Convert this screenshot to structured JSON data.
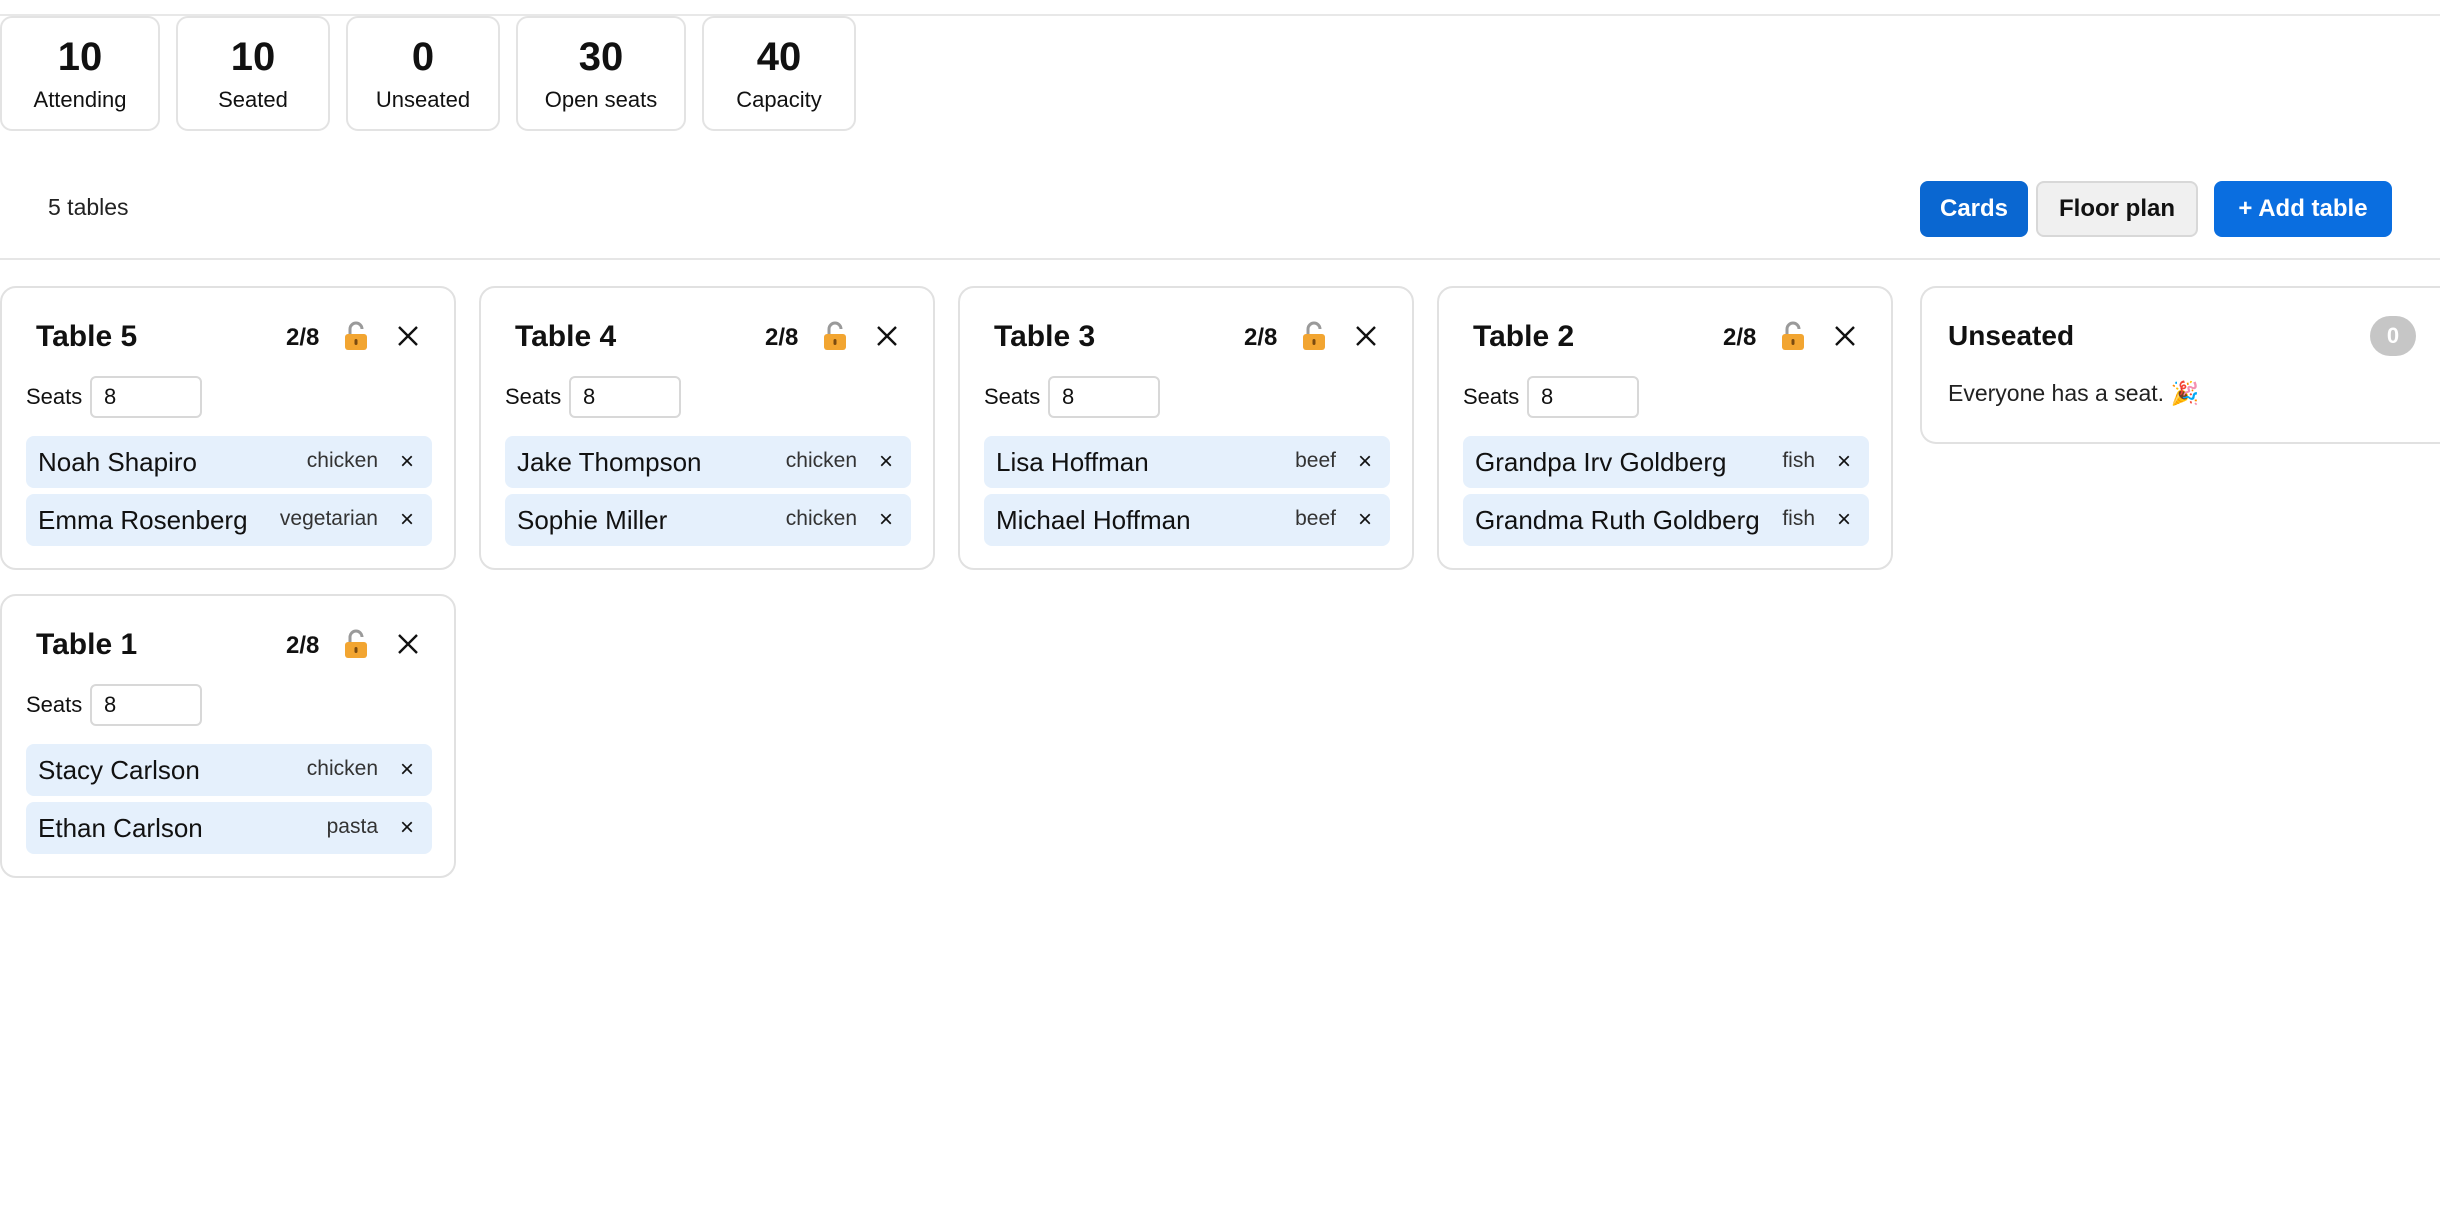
{
  "stats": [
    {
      "value": "10",
      "label": "Attending"
    },
    {
      "value": "10",
      "label": "Seated"
    },
    {
      "value": "0",
      "label": "Unseated"
    },
    {
      "value": "30",
      "label": "Open seats"
    },
    {
      "value": "40",
      "label": "Capacity"
    }
  ],
  "toolbar": {
    "count": "5 tables",
    "cards_label": "Cards",
    "floor_label": "Floor plan",
    "add_label": "+ Add table"
  },
  "tables": [
    {
      "name": "Table 5",
      "count": "2/8",
      "seats_label": "Seats",
      "seats": "8",
      "guests": [
        {
          "name": "Noah Shapiro",
          "meal": "chicken"
        },
        {
          "name": "Emma Rosenberg",
          "meal": "vegetarian"
        }
      ]
    },
    {
      "name": "Table 4",
      "count": "2/8",
      "seats_label": "Seats",
      "seats": "8",
      "guests": [
        {
          "name": "Jake Thompson",
          "meal": "chicken"
        },
        {
          "name": "Sophie Miller",
          "meal": "chicken"
        }
      ]
    },
    {
      "name": "Table 3",
      "count": "2/8",
      "seats_label": "Seats",
      "seats": "8",
      "guests": [
        {
          "name": "Lisa Hoffman",
          "meal": "beef"
        },
        {
          "name": "Michael Hoffman",
          "meal": "beef"
        }
      ]
    },
    {
      "name": "Table 2",
      "count": "2/8",
      "seats_label": "Seats",
      "seats": "8",
      "guests": [
        {
          "name": "Grandpa Irv Goldberg",
          "meal": "fish"
        },
        {
          "name": "Grandma Ruth Goldberg",
          "meal": "fish"
        }
      ]
    },
    {
      "name": "Table 1",
      "count": "2/8",
      "seats_label": "Seats",
      "seats": "8",
      "guests": [
        {
          "name": "Stacy Carlson",
          "meal": "chicken"
        },
        {
          "name": "Ethan Carlson",
          "meal": "pasta"
        }
      ]
    }
  ],
  "remove_glyph": "×",
  "unseated": {
    "title": "Unseated",
    "badge": "0",
    "message": "Everyone has a seat. 🎉"
  },
  "icons": {
    "lock": "unlocked-padlock-icon",
    "close": "close-icon"
  },
  "colors": {
    "primary": "#0a67d1",
    "guest_bg": "#e5f0fc",
    "badge": "#c6c6c6"
  }
}
